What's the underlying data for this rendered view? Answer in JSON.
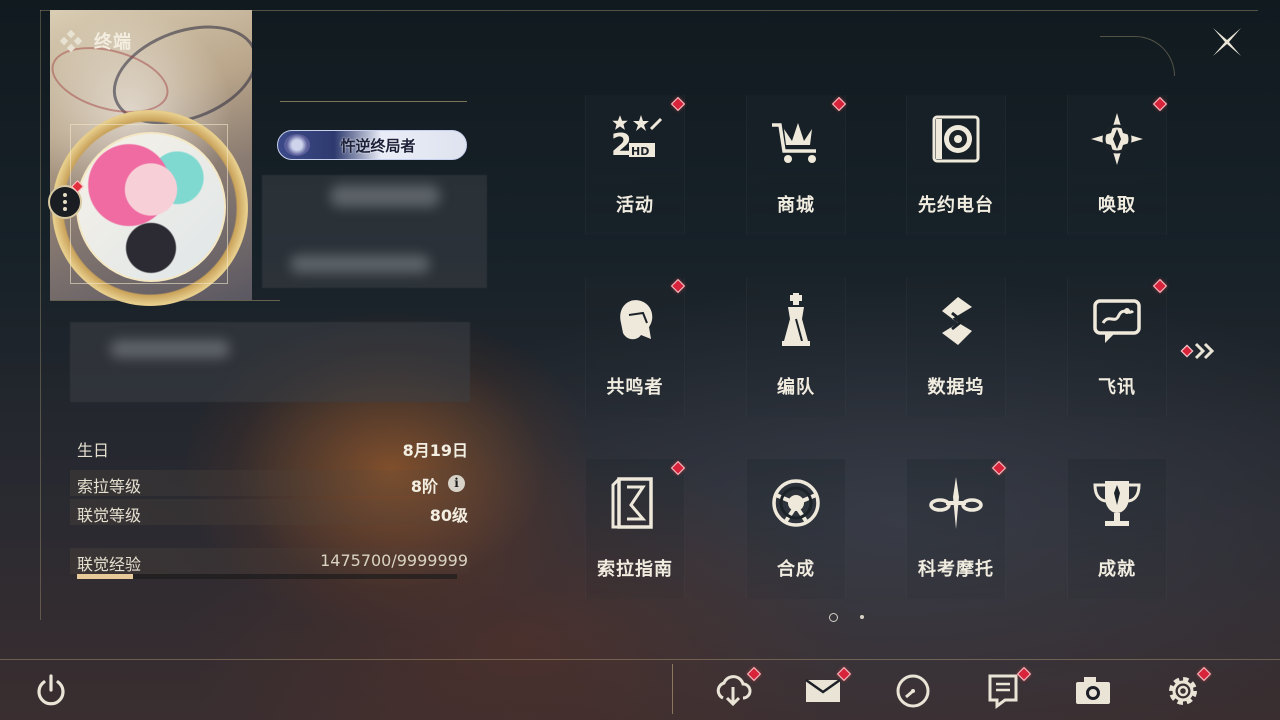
{
  "header": {
    "title": "终端"
  },
  "profile": {
    "badge_title": "忤逆终局者",
    "info": [
      {
        "label": "生日",
        "value": "8月19日"
      },
      {
        "label": "索拉等级",
        "value": "8阶"
      },
      {
        "label": "联觉等级",
        "value": "80级"
      }
    ],
    "xp": {
      "label": "联觉经验",
      "value": "1475700/9999999",
      "fraction": 0.148
    }
  },
  "menu": {
    "items": [
      {
        "label": "活动",
        "icon": "event-2hd-icon",
        "badge": true
      },
      {
        "label": "商城",
        "icon": "shop-cart-icon",
        "badge": true
      },
      {
        "label": "先约电台",
        "icon": "radio-icon",
        "badge": false
      },
      {
        "label": "唤取",
        "icon": "summon-compass-icon",
        "badge": true
      },
      {
        "label": "共鸣者",
        "icon": "resonator-portrait-icon",
        "badge": true
      },
      {
        "label": "编队",
        "icon": "team-chess-icon",
        "badge": false
      },
      {
        "label": "数据坞",
        "icon": "data-dock-icon",
        "badge": false
      },
      {
        "label": "飞讯",
        "icon": "chat-message-icon",
        "badge": true
      },
      {
        "label": "索拉指南",
        "icon": "guide-book-icon",
        "badge": true
      },
      {
        "label": "合成",
        "icon": "synthesis-icon",
        "badge": false
      },
      {
        "label": "科考摩托",
        "icon": "motorcycle-icon",
        "badge": true
      },
      {
        "label": "成就",
        "icon": "trophy-icon",
        "badge": false
      }
    ],
    "page_indicator": {
      "current": 1,
      "total": 2
    }
  },
  "bottom_bar": {
    "left": {
      "icon": "power-icon"
    },
    "right": [
      {
        "icon": "download-cloud-icon",
        "badge": true
      },
      {
        "icon": "mail-icon",
        "badge": true
      },
      {
        "icon": "clock-icon",
        "badge": false
      },
      {
        "icon": "notice-icon",
        "badge": true
      },
      {
        "icon": "camera-icon",
        "badge": false
      },
      {
        "icon": "settings-gear-icon",
        "badge": true
      }
    ]
  },
  "colors": {
    "accent_gold": "#d2be8c",
    "badge_red": "#d8243b",
    "text_light": "#f1ece0"
  }
}
